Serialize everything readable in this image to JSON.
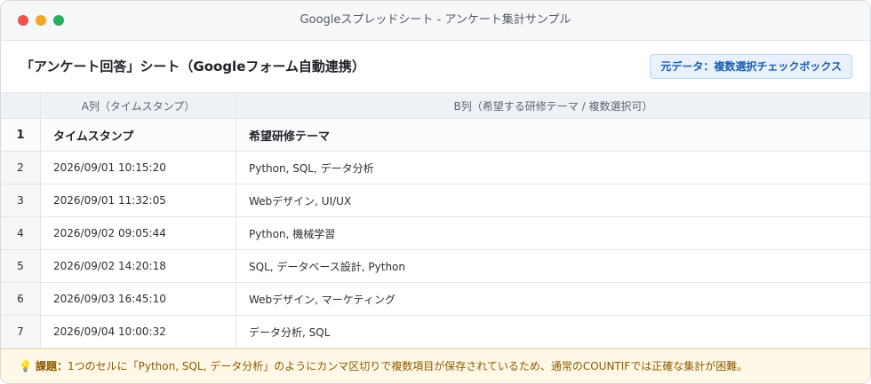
{
  "window": {
    "title": "Googleスプレッドシート - アンケート集計サンプル"
  },
  "header": {
    "sheet_title": "「アンケート回答」シート（Googleフォーム自動連携）",
    "source_badge": "元データ：複数選択チェックボックス"
  },
  "columns": {
    "a": "A列（タイムスタンプ）",
    "b": "B列（希望する研修テーマ / 複数選択可）"
  },
  "rows": [
    {
      "num": "1",
      "a": "タイムスタンプ",
      "b": "希望研修テーマ"
    },
    {
      "num": "2",
      "a": "2026/09/01 10:15:20",
      "b": "Python, SQL, データ分析"
    },
    {
      "num": "3",
      "a": "2026/09/01 11:32:05",
      "b": "Webデザイン, UI/UX"
    },
    {
      "num": "4",
      "a": "2026/09/02 09:05:44",
      "b": "Python, 機械学習"
    },
    {
      "num": "5",
      "a": "2026/09/02 14:20:18",
      "b": "SQL, データベース設計, Python"
    },
    {
      "num": "6",
      "a": "2026/09/03 16:45:10",
      "b": "Webデザイン, マーケティング"
    },
    {
      "num": "7",
      "a": "2026/09/04 10:00:32",
      "b": "データ分析, SQL"
    }
  ],
  "footer": {
    "icon": "lightbulb-icon",
    "label": "課題：",
    "text": "1つのセルに「Python, SQL, データ分析」のようにカンマ区切りで複数項目が保存されているため、通常のCOUNTIFでは正確な集計が困難。"
  }
}
